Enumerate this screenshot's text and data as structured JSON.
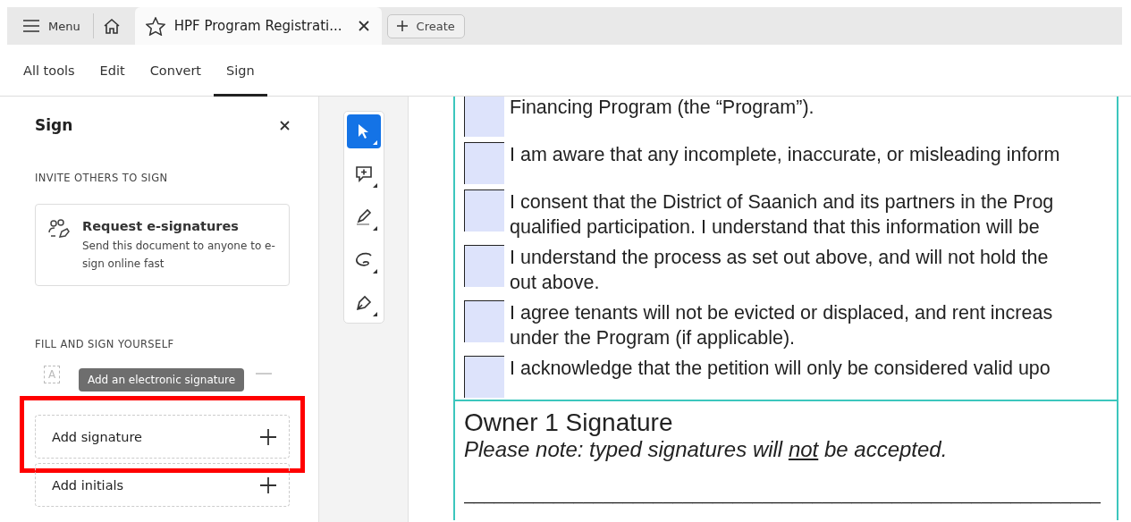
{
  "top_bar": {
    "menu_label": "Menu",
    "tab": {
      "title": "HPF Program Registrati...",
      "selected": true
    },
    "create_label": "Create"
  },
  "toolbar_tabs": [
    {
      "label": "All tools",
      "selected": false
    },
    {
      "label": "Edit",
      "selected": false
    },
    {
      "label": "Convert",
      "selected": false
    },
    {
      "label": "Sign",
      "selected": true
    }
  ],
  "sign_panel": {
    "title": "Sign",
    "invite_heading": "INVITE OTHERS TO SIGN",
    "request_card": {
      "title": "Request e-signatures",
      "description": "Send this document to anyone to e-sign online fast"
    },
    "fill_heading": "FILL AND SIGN YOURSELF",
    "field_icon_letter": "A",
    "tooltip": "Add an electronic signature",
    "actions": [
      {
        "label": "Add signature",
        "highlighted": true
      },
      {
        "label": "Add initials",
        "highlighted": false
      }
    ]
  },
  "tools": [
    {
      "kind": "select",
      "selected": true
    },
    {
      "kind": "comment",
      "selected": false
    },
    {
      "kind": "highlight",
      "selected": false
    },
    {
      "kind": "draw",
      "selected": false
    },
    {
      "kind": "sign",
      "selected": false
    }
  ],
  "document": {
    "items": [
      {
        "lines": [
          "Financing Program (the “Program”)."
        ]
      },
      {
        "lines": [
          "I am aware that any incomplete, inaccurate, or misleading inform"
        ]
      },
      {
        "lines": [
          "I consent that the District of Saanich and its partners in the Prog",
          "qualified participation. I understand that this information will be"
        ]
      },
      {
        "lines": [
          "I understand the process as set out above, and will not hold the",
          "out above."
        ]
      },
      {
        "lines": [
          "I agree tenants will not be evicted or displaced, and rent increas",
          "under the Program (if applicable)."
        ]
      },
      {
        "lines": [
          "I acknowledge that the petition will only be considered valid upo"
        ]
      }
    ],
    "signature_title": "Owner 1 Signature",
    "note": [
      {
        "text": "Please note: typed signatures will ",
        "underline": false
      },
      {
        "text": "not",
        "underline": true
      },
      {
        "text": " be accepted.",
        "underline": false
      }
    ],
    "signature_line": "________________________________________________________________"
  }
}
